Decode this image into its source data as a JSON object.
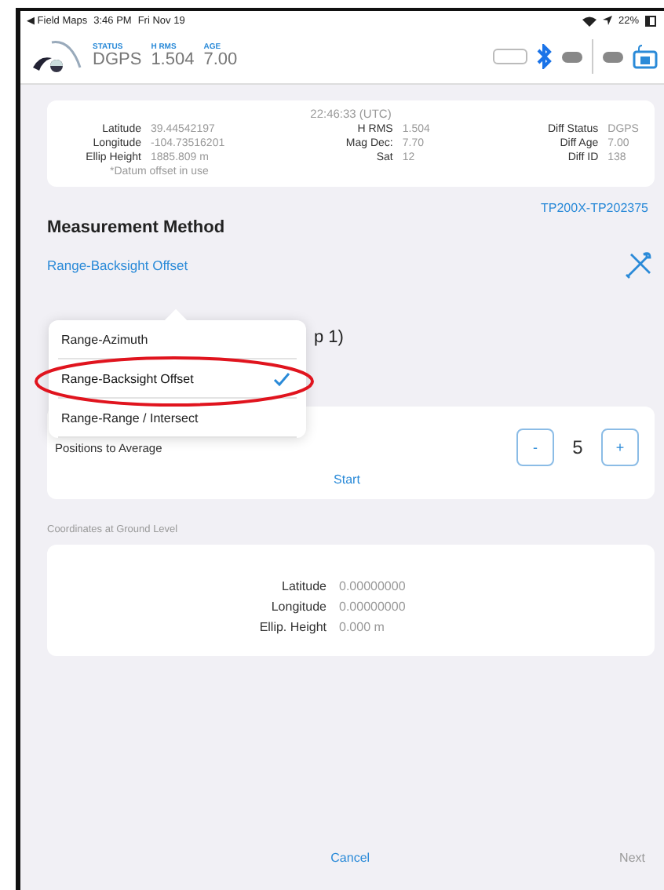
{
  "status_bar": {
    "back_app": "◀ Field Maps",
    "time": "3:46 PM",
    "date": "Fri Nov 19",
    "battery": "22%"
  },
  "header": {
    "fields": [
      {
        "label": "STATUS",
        "value": "DGPS"
      },
      {
        "label": "H RMS",
        "value": "1.504"
      },
      {
        "label": "AGE",
        "value": "7.00"
      }
    ]
  },
  "gnss_card": {
    "time": "22:46:33 (UTC)",
    "columns": [
      [
        {
          "label": "Latitude",
          "value": "39.44542197"
        },
        {
          "label": "Longitude",
          "value": "-104.73516201"
        },
        {
          "label": "Ellip Height",
          "value": "1885.809 m"
        }
      ],
      [
        {
          "label": "H RMS",
          "value": "1.504"
        },
        {
          "label": "Mag Dec:",
          "value": "7.70"
        },
        {
          "label": "Sat",
          "value": "12"
        }
      ],
      [
        {
          "label": "Diff Status",
          "value": "DGPS"
        },
        {
          "label": "Diff Age",
          "value": "7.00"
        },
        {
          "label": "Diff ID",
          "value": "138"
        }
      ]
    ],
    "note": "*Datum offset in use"
  },
  "receiver": "TP200X-TP202375",
  "measurement_method": {
    "title": "Measurement Method",
    "value": "Range-Backsight Offset",
    "hidden_heading": "p 1)"
  },
  "dropdown": {
    "options": [
      {
        "label": "Range-Azimuth",
        "selected": false
      },
      {
        "label": "Range-Backsight Offset",
        "selected": true
      },
      {
        "label": "Range-Range / Intersect",
        "selected": false
      }
    ]
  },
  "averaging": {
    "label": "Positions to Average",
    "minus": "-",
    "count": "5",
    "plus": "+",
    "start": "Start"
  },
  "ground": {
    "title": "Coordinates at Ground Level",
    "rows": [
      {
        "label": "Latitude",
        "value": "0.00000000"
      },
      {
        "label": "Longitude",
        "value": "0.00000000"
      },
      {
        "label": "Ellip. Height",
        "value": "0.000 m"
      }
    ]
  },
  "footer": {
    "cancel": "Cancel",
    "next": "Next",
    "next_disabled": true
  }
}
